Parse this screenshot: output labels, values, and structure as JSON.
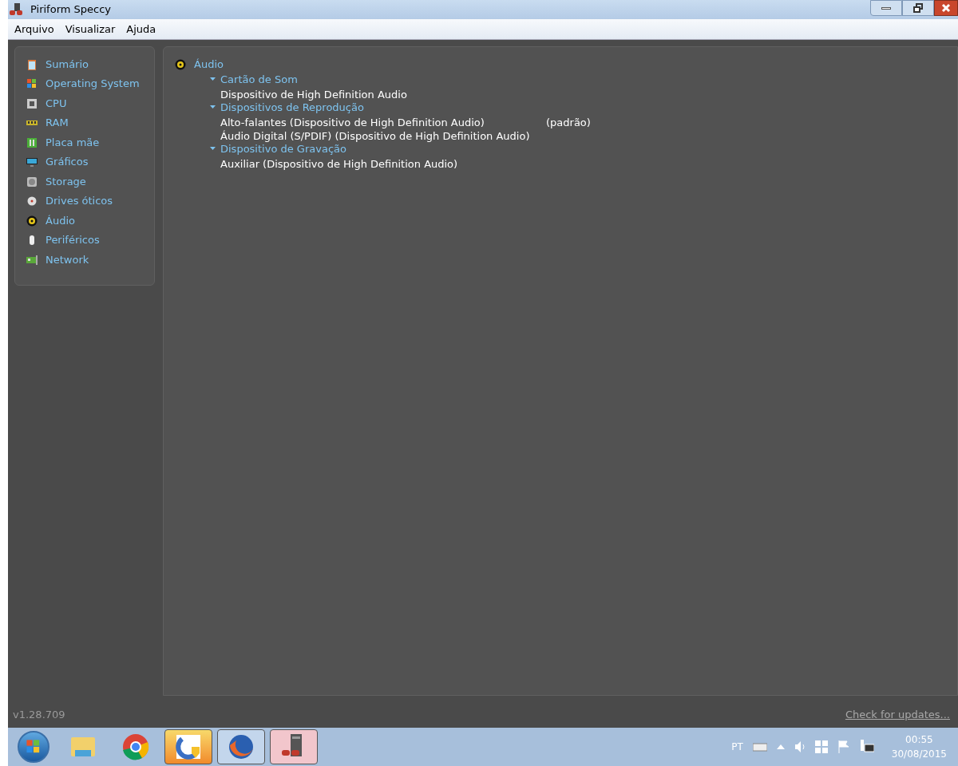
{
  "window": {
    "title": "Piriform Speccy"
  },
  "menu": [
    "Arquivo",
    "Visualizar",
    "Ajuda"
  ],
  "sidebar": {
    "items": [
      {
        "label": "Sumário"
      },
      {
        "label": "Operating System"
      },
      {
        "label": "CPU"
      },
      {
        "label": "RAM"
      },
      {
        "label": "Placa mãe"
      },
      {
        "label": "Gráficos"
      },
      {
        "label": "Storage"
      },
      {
        "label": "Drives óticos"
      },
      {
        "label": "Áudio"
      },
      {
        "label": "Periféricos"
      },
      {
        "label": "Network"
      }
    ]
  },
  "content": {
    "title": "Áudio",
    "sections": [
      {
        "label": "Cartão de Som",
        "expanded": true,
        "children": [
          {
            "label": "Dispositivo de High Definition Audio"
          }
        ]
      },
      {
        "label": "Dispositivos de Reprodução",
        "expanded": true,
        "children": [
          {
            "label": "Alto-falantes (Dispositivo de High Definition Audio)",
            "note": "(padrão)"
          },
          {
            "label": "Áudio Digital (S/PDIF) (Dispositivo de High Definition Audio)"
          }
        ]
      },
      {
        "label": "Dispositivo de Gravação",
        "expanded": true,
        "children": [
          {
            "label": "Auxiliar (Dispositivo de High Definition Audio)"
          }
        ]
      }
    ]
  },
  "status_bar": {
    "version": "v1.28.709",
    "link": "Check for updates..."
  },
  "taskbar": {
    "apps": [
      {
        "open": false,
        "selected": false
      },
      {
        "open": false,
        "selected": false
      },
      {
        "open": true,
        "selected": true
      },
      {
        "open": true,
        "selected": false
      },
      {
        "open": true,
        "selected": false
      }
    ],
    "language": "PT",
    "time": "00:55",
    "date": "30/08/2015"
  }
}
